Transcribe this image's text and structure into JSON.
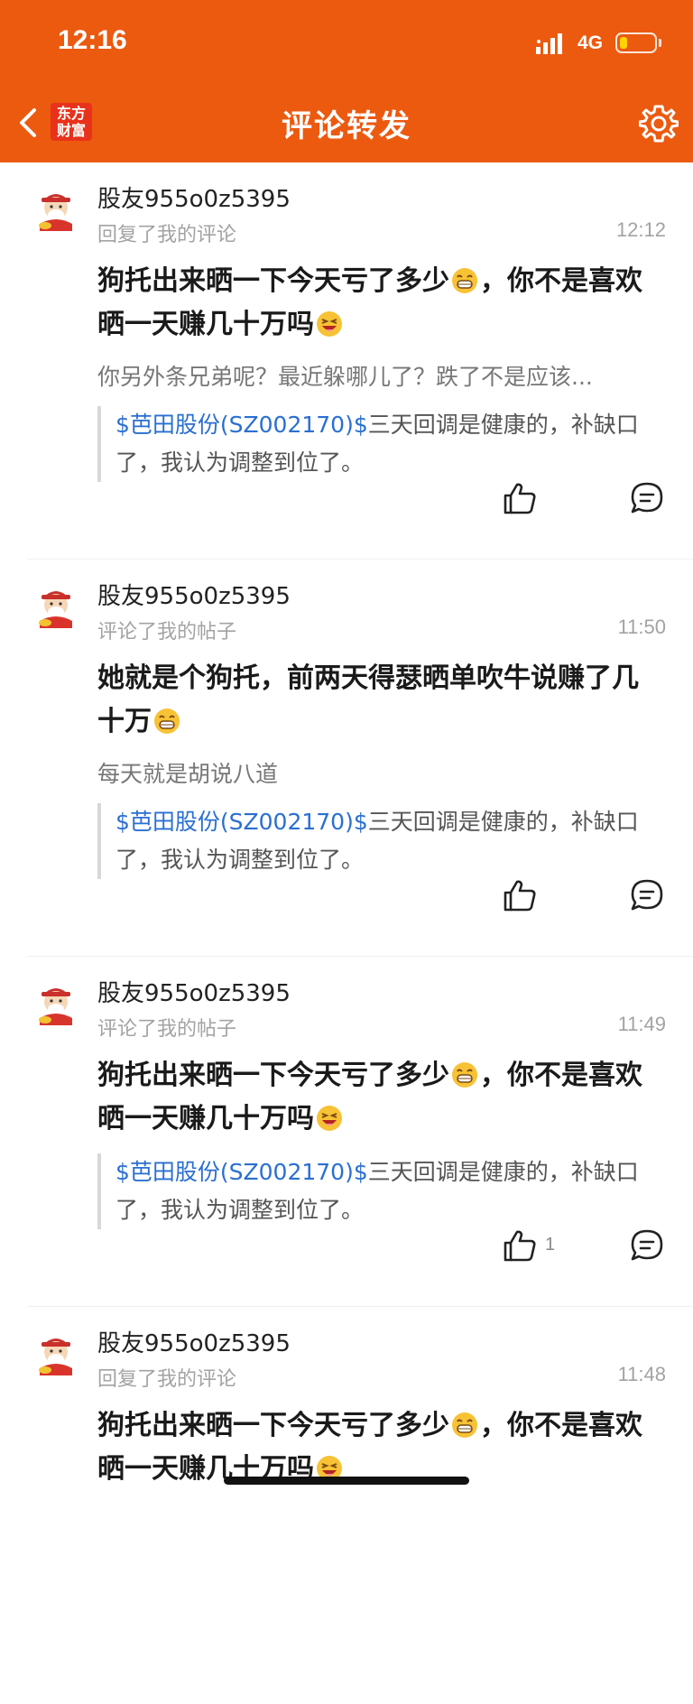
{
  "status_bar": {
    "time": "12:16",
    "network": "4G"
  },
  "nav": {
    "title": "评论转发",
    "logo_line1": "东方",
    "logo_line2": "财富"
  },
  "notifications": [
    {
      "username": "股友955o0z5395",
      "action": "回复了我的评论",
      "time": "12:12",
      "text_part1": "狗托出来晒一下今天亏了多少",
      "text_part2": "，你不是喜欢晒一天赚几十万吗",
      "excerpt": "你另外条兄弟呢？最近躲哪儿了？跌了不是应该...",
      "quote_link": "$芭田股份(SZ002170)$",
      "quote_text": "三天回调是健康的，补缺口了，我认为调整到位了。",
      "likes": ""
    },
    {
      "username": "股友955o0z5395",
      "action": "评论了我的帖子",
      "time": "11:50",
      "text_part1": "她就是个狗托，前两天得瑟晒单吹牛说赚了几十万",
      "excerpt": "每天就是胡说八道",
      "quote_link": "$芭田股份(SZ002170)$",
      "quote_text": "三天回调是健康的，补缺口了，我认为调整到位了。",
      "likes": ""
    },
    {
      "username": "股友955o0z5395",
      "action": "评论了我的帖子",
      "time": "11:49",
      "text_part1": "狗托出来晒一下今天亏了多少",
      "text_part2": "，你不是喜欢晒一天赚几十万吗",
      "quote_link": "$芭田股份(SZ002170)$",
      "quote_text": "三天回调是健康的，补缺口了，我认为调整到位了。",
      "likes": "1"
    },
    {
      "username": "股友955o0z5395",
      "action": "回复了我的评论",
      "time": "11:48",
      "text_part1": "狗托出来晒一下今天亏了多少",
      "text_part2": "，你不是喜欢晒一天赚几十万吗"
    }
  ],
  "colors": {
    "accent": "#ec5a10",
    "link": "#2a6fd1"
  },
  "icons": [
    "back-arrow-icon",
    "settings-gear-icon",
    "thumbs-up-icon",
    "comment-bubble-icon",
    "grin-emoji-icon",
    "laugh-emoji-icon"
  ]
}
